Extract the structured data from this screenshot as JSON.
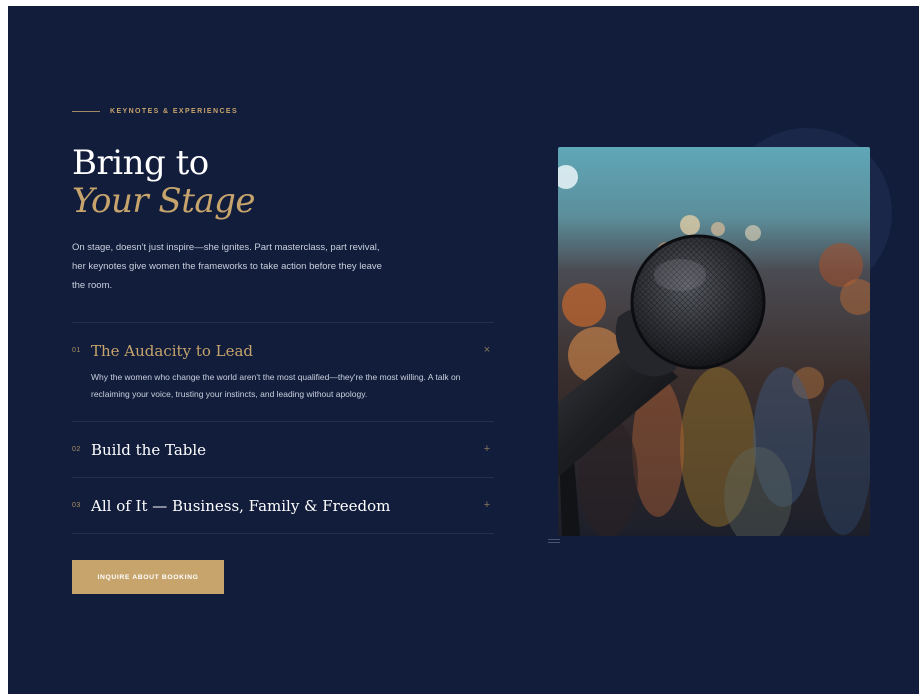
{
  "eyebrow": "KEYNOTES & EXPERIENCES",
  "heading": {
    "line1": "Bring to",
    "line2": "Your Stage"
  },
  "intro": "On stage, doesn't just inspire—she ignites. Part masterclass, part revival, her keynotes give women the frameworks to take action before they leave the room.",
  "accordion": [
    {
      "number": "01",
      "title": "The Audacity to Lead",
      "toggle": "×",
      "expanded": true,
      "body": "Why the women who change the world aren't the most qualified—they're the most willing. A talk on reclaiming your voice, trusting your instincts, and leading without apology."
    },
    {
      "number": "02",
      "title": "Build the Table",
      "toggle": "+",
      "expanded": false
    },
    {
      "number": "03",
      "title": "All of It — Business, Family & Freedom",
      "toggle": "+",
      "expanded": false
    }
  ],
  "cta_label": "INQUIRE ABOUT BOOKING",
  "colors": {
    "background": "#111d3b",
    "accent": "#c7a46c",
    "text": "#ffffff",
    "muted_text": "#c9cfdd"
  },
  "icons": {
    "image": "microphone-photo",
    "menu": "lines-icon"
  }
}
